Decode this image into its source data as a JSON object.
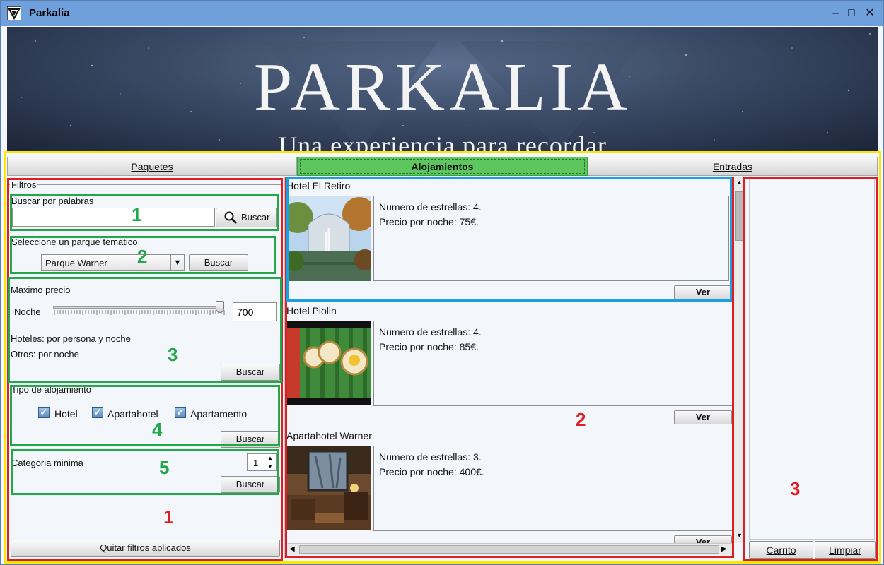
{
  "window": {
    "title": "Parkalia"
  },
  "banner": {
    "title": "PARKALIA",
    "subtitle": "Una experiencia para recordar"
  },
  "tabs": [
    {
      "label": "Paquetes"
    },
    {
      "label": "Alojamientos"
    },
    {
      "label": "Entradas"
    }
  ],
  "filters": {
    "legend": "Filtros",
    "words": {
      "label": "Buscar por palabras",
      "value": "",
      "button": "Buscar"
    },
    "park": {
      "label": "Seleccione un parque tematico",
      "selected": "Parque Warner",
      "button": "Buscar"
    },
    "price": {
      "label": "Maximo precio",
      "slider_label": "Noche",
      "value": "700",
      "note1": "Hoteles: por persona y noche",
      "note2": "Otros: por noche",
      "button": "Buscar",
      "slider_level": 1.0
    },
    "type": {
      "label": "Tipo de alojamiento",
      "options": [
        {
          "label": "Hotel",
          "checked": true
        },
        {
          "label": "Apartahotel",
          "checked": true
        },
        {
          "label": "Apartamento",
          "checked": true
        }
      ],
      "button": "Buscar"
    },
    "category": {
      "label": "Categoria minima",
      "value": "1",
      "button": "Buscar"
    },
    "clear_button": "Quitar filtros aplicados"
  },
  "results": [
    {
      "name": "Hotel El Retiro",
      "stars": "Numero de estrellas: 4.",
      "price": "Precio por noche: 75€.",
      "button": "Ver"
    },
    {
      "name": "Hotel Piolin",
      "stars": "Numero de estrellas: 4.",
      "price": "Precio por noche: 85€.",
      "button": "Ver"
    },
    {
      "name": "Apartahotel Warner",
      "stars": "Numero de estrellas: 3.",
      "price": "Precio por noche: 400€.",
      "button": "Ver"
    }
  ],
  "cart": {
    "cart_button": "Carrito",
    "clear_button": "Limpiar"
  },
  "annotations": {
    "green": [
      "1",
      "2",
      "3",
      "4",
      "5"
    ],
    "red": [
      "1",
      "2",
      "3"
    ],
    "colors": {
      "red": "#e01c24",
      "green": "#22a84a",
      "blue": "#1aa0e0",
      "yellow": "#ffe600"
    }
  }
}
